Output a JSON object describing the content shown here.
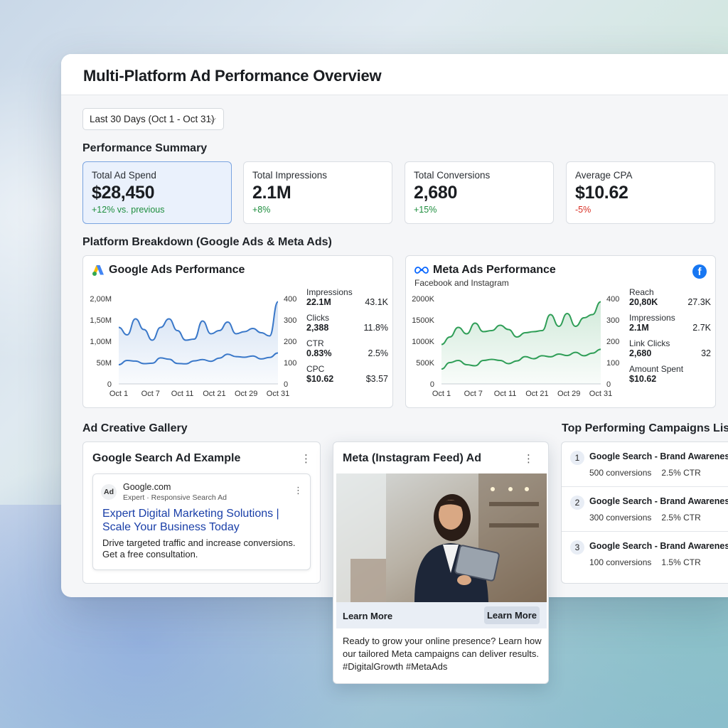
{
  "window": {
    "title": "Multi-Platform Ad Performance Overview"
  },
  "date_range": {
    "label": "Last 30 Days (Oct 1 - Oct 31)",
    "icon": "chevron-down-icon"
  },
  "sections": {
    "summary": "Performance Summary",
    "breakdown": "Platform Breakdown (Google Ads & Meta Ads)",
    "gallery": "Ad Creative Gallery",
    "campaigns": "Top Performing Campaigns List"
  },
  "kpis": [
    {
      "label": "Total Ad Spend",
      "value": "$28,450",
      "change": "+12% vs. previous",
      "trend": "positive"
    },
    {
      "label": "Total Impressions",
      "value": "2.1M",
      "change": "+8%",
      "trend": "positive"
    },
    {
      "label": "Total Conversions",
      "value": "2,680",
      "change": "+15%",
      "trend": "positive"
    },
    {
      "label": "Average CPA",
      "value": "$10.62",
      "change": "-5%",
      "trend": "negative"
    }
  ],
  "google_panel": {
    "title": "Google Ads Performance",
    "icon": "google-ads-icon",
    "metrics": [
      {
        "label": "Impressions",
        "value": "22.1M",
        "right": "43.1K"
      },
      {
        "label": "Clicks",
        "value": "2,388",
        "right": "11.8%"
      },
      {
        "label": "CTR",
        "value": "0.83%",
        "right": "2.5%"
      },
      {
        "label": "CPC",
        "value": "$10.62",
        "right": "$3.57"
      }
    ]
  },
  "meta_panel": {
    "title": "Meta Ads Performance",
    "subtitle": "Facebook and Instagram",
    "icon": "meta-infinity-icon",
    "badge_icon": "facebook-icon",
    "metrics": [
      {
        "label": "Reach",
        "value": "20,80K",
        "right": "27.3K"
      },
      {
        "label": "Impressions",
        "value": "2.1M",
        "right": "2.7K"
      },
      {
        "label": "Link Clicks",
        "value": "2,680",
        "right": "32"
      },
      {
        "label": "Amount Spent",
        "value": "$10.62",
        "right": ""
      }
    ]
  },
  "chart_data": [
    {
      "type": "line",
      "title": "Google Ads Performance",
      "x": [
        "Oct 1",
        "Oct 7",
        "Oct 11",
        "Oct 21",
        "Oct 29",
        "Oct 31"
      ],
      "y_left_ticks": [
        "0",
        "50M",
        "1,00M",
        "1,50M",
        "2,00M"
      ],
      "y_right_ticks": [
        "0",
        "100",
        "200",
        "300",
        "400"
      ],
      "ylim_right": [
        0,
        400
      ],
      "color": "#3a78c9",
      "series": [
        {
          "values": [
            265,
            230,
            305,
            255,
            205,
            265,
            305,
            250,
            205,
            210,
            295,
            235,
            250,
            290,
            235,
            245,
            260,
            240,
            225,
            385
          ]
        },
        {
          "values": [
            90,
            110,
            107,
            95,
            97,
            122,
            116,
            96,
            94,
            108,
            114,
            106,
            121,
            139,
            128,
            125,
            131,
            117,
            124,
            145
          ]
        }
      ]
    },
    {
      "type": "line",
      "title": "Meta Ads Performance",
      "x": [
        "Oct 1",
        "Oct 7",
        "Oct 11",
        "Oct 21",
        "Oct 29",
        "Oct 31"
      ],
      "y_left_ticks": [
        "0",
        "500K",
        "1000K",
        "1500K",
        "2000K"
      ],
      "y_right_ticks": [
        "0",
        "100",
        "200",
        "300",
        "400"
      ],
      "ylim_right": [
        0,
        400
      ],
      "color": "#2f9e57",
      "series": [
        {
          "values": [
            185,
            220,
            265,
            235,
            285,
            245,
            250,
            275,
            255,
            220,
            240,
            245,
            250,
            325,
            270,
            330,
            270,
            310,
            325,
            385
          ]
        },
        {
          "values": [
            70,
            100,
            110,
            90,
            85,
            110,
            115,
            110,
            95,
            108,
            128,
            118,
            132,
            127,
            140,
            133,
            148,
            132,
            144,
            162
          ]
        }
      ]
    }
  ],
  "google_ad": {
    "card_title": "Google Search Ad Example",
    "badge": "Ad",
    "domain": "Google.com",
    "sub": "Expert · Responsive Search Ad",
    "headline": "Expert Digital Marketing Solutions | Scale Your Business Today",
    "description": "Drive targeted traffic and increase conversions. Get a free consultation."
  },
  "meta_ad": {
    "card_title": "Meta (Instagram Feed) Ad",
    "cta_label": "Learn More",
    "cta_button": "Learn More",
    "copy": "Ready to grow your online presence? Learn how our tailored Meta campaigns can deliver results. #DigitalGrowth #MetaAds"
  },
  "campaigns": [
    {
      "rank": "1",
      "name": "Google Search - Brand Awareness",
      "conversions": "500 conversions",
      "ctr": "2.5% CTR"
    },
    {
      "rank": "2",
      "name": "Google Search - Brand Awareness",
      "conversions": "300 conversions",
      "ctr": "2.5% CTR"
    },
    {
      "rank": "3",
      "name": "Google Search - Brand Awareness",
      "conversions": "100 conversions",
      "ctr": "1.5% CTR"
    }
  ]
}
